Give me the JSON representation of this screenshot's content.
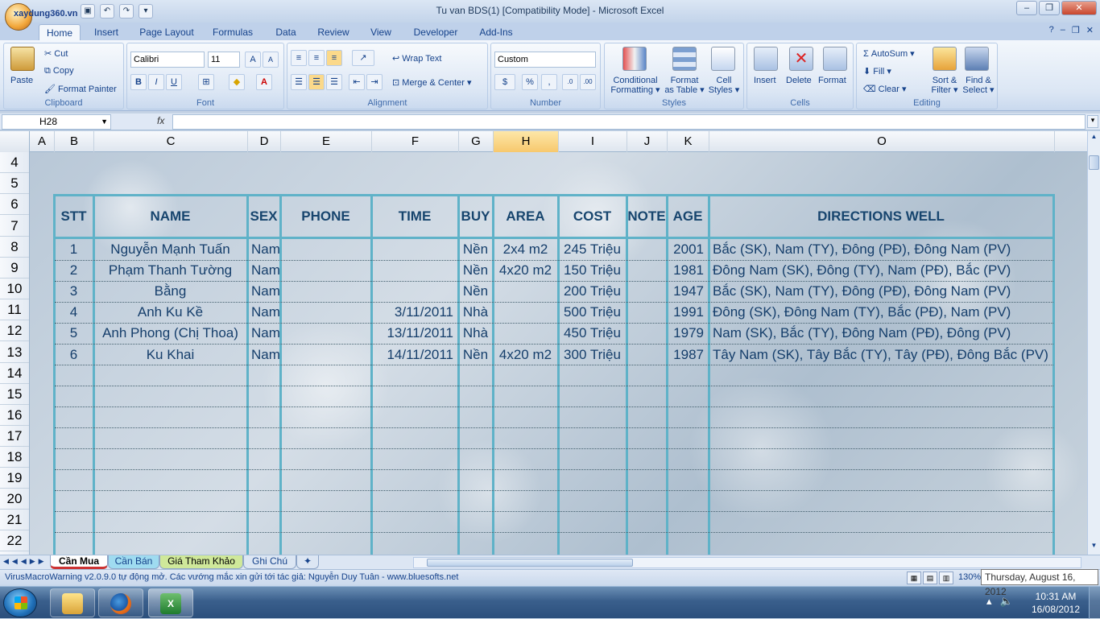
{
  "window": {
    "title": "Tu van BDS(1)  [Compatibility Mode] - Microsoft Excel",
    "office_button_text": "xaydung360.vn"
  },
  "ribbon_tabs": [
    "Home",
    "Insert",
    "Page Layout",
    "Formulas",
    "Data",
    "Review",
    "View",
    "Developer",
    "Add-Ins"
  ],
  "clipboard": {
    "paste": "Paste",
    "cut": "Cut",
    "copy": "Copy",
    "format_painter": "Format Painter",
    "label": "Clipboard"
  },
  "font": {
    "name": "Calibri",
    "size": "11",
    "bold": "B",
    "italic": "I",
    "underline": "U",
    "label": "Font"
  },
  "alignment": {
    "wrap_text": "Wrap Text",
    "merge_center": "Merge & Center",
    "label": "Alignment"
  },
  "number": {
    "format": "Custom",
    "currency": "$",
    "percent": "%",
    "comma": ",",
    "label": "Number"
  },
  "styles": {
    "conditional_1": "Conditional",
    "conditional_2": "Formatting",
    "format_table_1": "Format",
    "format_table_2": "as Table",
    "cell_styles_1": "Cell",
    "cell_styles_2": "Styles",
    "label": "Styles"
  },
  "cells": {
    "insert": "Insert",
    "delete": "Delete",
    "format": "Format",
    "label": "Cells"
  },
  "editing": {
    "autosum": "AutoSum",
    "fill": "Fill",
    "clear": "Clear",
    "sort_1": "Sort &",
    "sort_2": "Filter",
    "find_1": "Find &",
    "find_2": "Select",
    "label": "Editing"
  },
  "formula_bar": {
    "name_box": "H28",
    "fx": "fx",
    "value": ""
  },
  "columns": [
    "A",
    "B",
    "C",
    "D",
    "E",
    "F",
    "G",
    "H",
    "I",
    "J",
    "K",
    "O"
  ],
  "selected_column": "H",
  "rows": [
    "4",
    "5",
    "6",
    "7",
    "8",
    "9",
    "10",
    "11",
    "12",
    "13",
    "14",
    "15",
    "16",
    "17",
    "18",
    "19",
    "20",
    "21",
    "22"
  ],
  "table": {
    "headers": [
      "STT",
      "NAME",
      "SEX",
      "PHONE",
      "TIME",
      "BUY",
      "AREA",
      "COST",
      "NOTE",
      "AGE",
      "DIRECTIONS WELL"
    ],
    "records": [
      [
        "1",
        "Nguyễn Mạnh Tuấn",
        "Nam",
        "",
        "",
        "Nền",
        "2x4 m2",
        "245 Triệu",
        "",
        "2001",
        "Bắc (SK), Nam (TY), Đông (PĐ), Đông Nam (PV)"
      ],
      [
        "2",
        "Phạm Thanh Tường",
        "Nam",
        "",
        "",
        "Nền",
        "4x20 m2",
        "150 Triệu",
        "",
        "1981",
        "Đông Nam (SK), Đông (TY), Nam (PĐ), Bắc (PV)"
      ],
      [
        "3",
        "Bằng",
        "Nam",
        "",
        "",
        "Nền",
        "",
        "200 Triệu",
        "",
        "1947",
        "Bắc (SK), Nam (TY), Đông (PĐ), Đông Nam (PV)"
      ],
      [
        "4",
        "Anh Ku Kề",
        "Nam",
        "",
        "3/11/2011",
        "Nhà",
        "",
        "500 Triệu",
        "",
        "1991",
        "Đông (SK), Đông Nam (TY), Bắc (PĐ), Nam  (PV)"
      ],
      [
        "5",
        "Anh Phong (Chị Thoa)",
        "Nam",
        "",
        "13/11/2011",
        "Nhà",
        "",
        "450 Triệu",
        "",
        "1979",
        "Nam (SK), Bắc (TY), Đông Nam (PĐ),  Đông (PV)"
      ],
      [
        "6",
        "Ku Khai",
        "Nam",
        "",
        "14/11/2011",
        "Nền",
        "4x20 m2",
        "300 Triệu",
        "",
        "1987",
        "Tây Nam (SK), Tây Bắc (TY), Tây (PĐ), Đông Bắc  (PV)"
      ]
    ]
  },
  "sheet_tabs": [
    "Cần Mua",
    "Cần Bán",
    "Giá Tham Khảo",
    "Ghi Chú"
  ],
  "status": {
    "message": "VirusMacroWarning v2.0.9.0 tự động mở. Các vướng mắc xin gửi tới tác giả: Nguyễn Duy Tuân - www.bluesofts.net",
    "zoom": "130%",
    "date_tooltip": "Thursday, August 16, 2012"
  },
  "taskbar": {
    "time": "10:31 AM",
    "date": "16/08/2012"
  },
  "colors": {
    "table_border": "#5fb2c8",
    "header_text": "#17456e",
    "cell_text": "#153e6b",
    "selected_column": "#f7c86d"
  }
}
